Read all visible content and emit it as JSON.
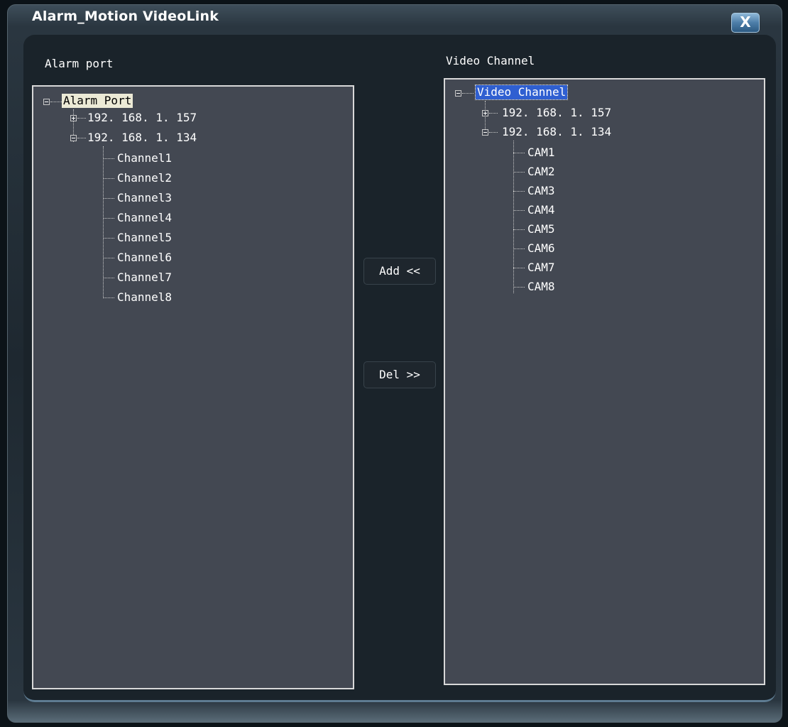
{
  "window": {
    "title": "Alarm_Motion VideoLink",
    "close_glyph": "X"
  },
  "alarm_panel": {
    "label": "Alarm port",
    "root": "Alarm Port",
    "hosts": [
      "192. 168. 1. 157",
      "192. 168. 1. 134"
    ],
    "channels": [
      "Channel1",
      "Channel2",
      "Channel3",
      "Channel4",
      "Channel5",
      "Channel6",
      "Channel7",
      "Channel8"
    ]
  },
  "video_panel": {
    "label": "Video Channel",
    "root": "Video Channel",
    "hosts": [
      "192. 168. 1. 157",
      "192. 168. 1. 134"
    ],
    "cams": [
      "CAM1",
      "CAM2",
      "CAM3",
      "CAM4",
      "CAM5",
      "CAM6",
      "CAM7",
      "CAM8"
    ]
  },
  "buttons": {
    "add": "Add <<",
    "del": "Del >>"
  },
  "colors": {
    "panel_bg": "#434852",
    "selection_blue": "#2f5fd1",
    "selection_light": "#ecead6"
  }
}
